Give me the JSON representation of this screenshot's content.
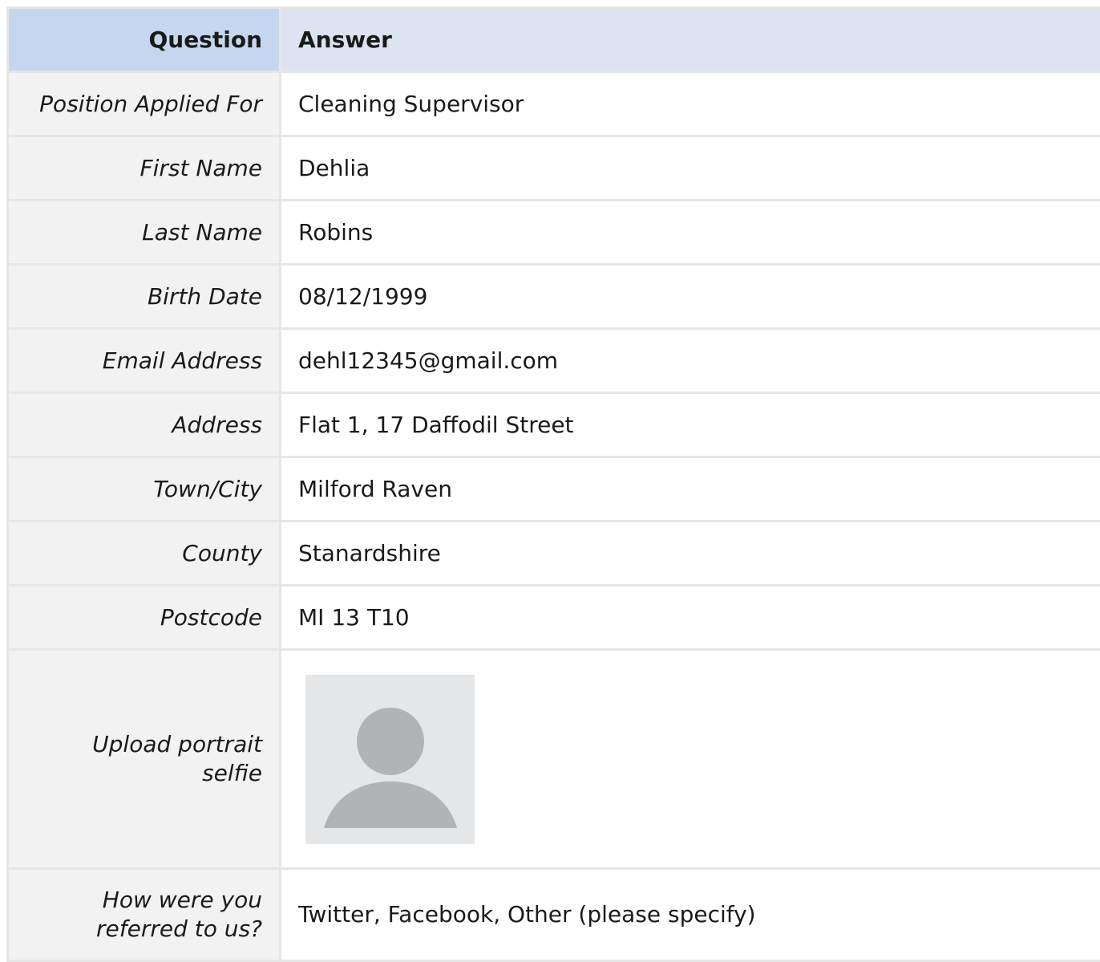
{
  "header": {
    "question_label": "Question",
    "answer_label": "Answer"
  },
  "rows": [
    {
      "question": "Position Applied For",
      "answer": "Cleaning Supervisor"
    },
    {
      "question": "First Name",
      "answer": "Dehlia"
    },
    {
      "question": "Last Name",
      "answer": "Robins"
    },
    {
      "question": "Birth Date",
      "answer": "08/12/1999"
    },
    {
      "question": "Email Address",
      "answer": "dehl12345@gmail.com"
    },
    {
      "question": "Address",
      "answer": "Flat 1, 17 Daffodil Street"
    },
    {
      "question": "Town/City",
      "answer": "Milford Raven"
    },
    {
      "question": "County",
      "answer": "Stanardshire"
    },
    {
      "question": "Postcode",
      "answer": "MI 13 T10"
    },
    {
      "question": "Upload portrait selfie",
      "answer_image": "avatar-placeholder-icon"
    },
    {
      "question": "How were you referred to us?",
      "answer": "Twitter, Facebook, Other (please specify)"
    }
  ],
  "colors": {
    "header_question_bg": "#c5d7ee",
    "header_answer_bg": "#dbe4f0",
    "question_cell_bg": "#f2f2f2",
    "border": "#e6e6e6",
    "avatar_bg": "#e4e6e8",
    "avatar_fg": "#b0b4b7"
  }
}
